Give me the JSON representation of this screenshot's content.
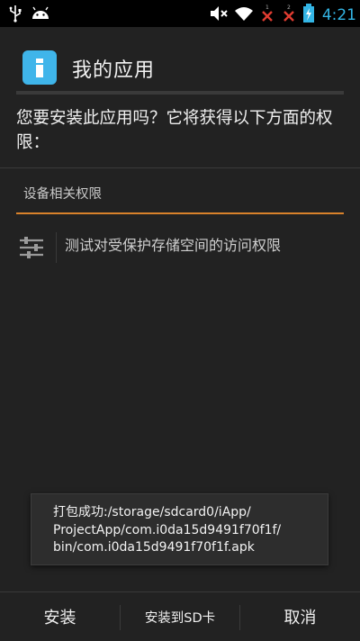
{
  "status_bar": {
    "time": "4:21",
    "icons": [
      "usb-icon",
      "android-icon",
      "mute-icon",
      "wifi-icon",
      "signal-1-icon",
      "signal-2-icon",
      "battery-charging-icon"
    ]
  },
  "header": {
    "title": "我的应用",
    "app_icon": "info-i-icon",
    "accent": "#3fb5ea"
  },
  "question": "您要安装此应用吗？它将获得以下方面的权限：",
  "section": {
    "title": "设备相关权限",
    "underline_color": "#d9822b"
  },
  "permissions": [
    {
      "icon": "sliders-icon",
      "label": "测试对受保护存储空间的访问权限"
    }
  ],
  "toast": {
    "text": "打包成功:/storage/sdcard0/iApp/\nProjectApp/com.i0da15d9491f70f1f/\nbin/com.i0da15d9491f70f1f.apk"
  },
  "buttons": {
    "install": "安装",
    "install_sd": "安装到SD卡",
    "cancel": "取消"
  }
}
